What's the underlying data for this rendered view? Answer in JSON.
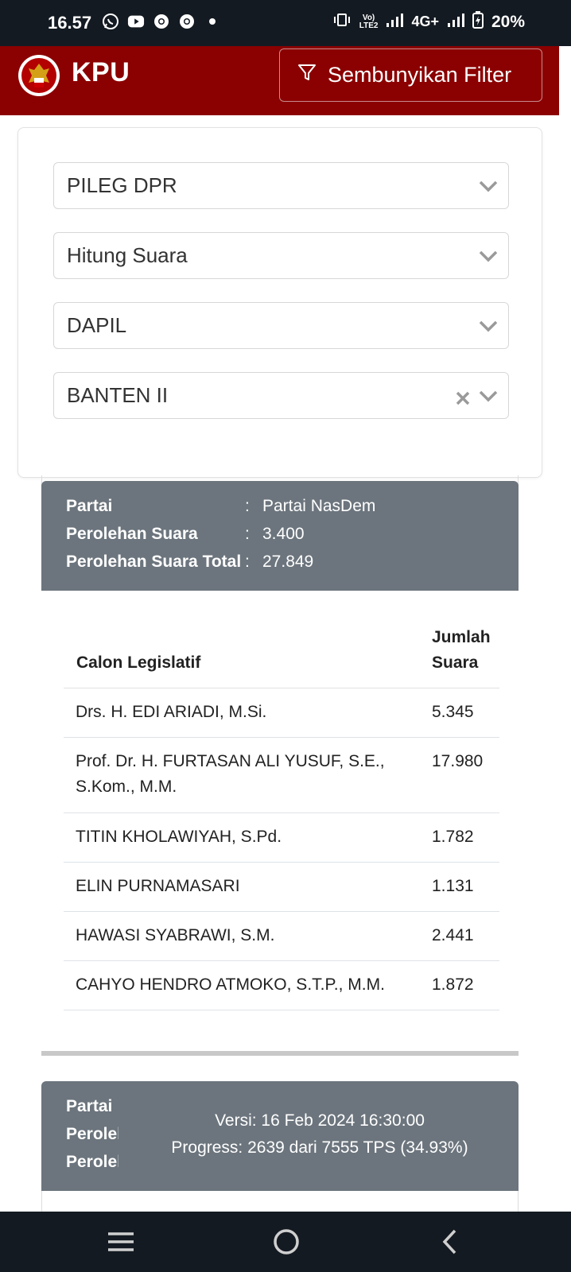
{
  "status_bar": {
    "time": "16.57",
    "network": "4G+",
    "battery": "20%",
    "icons": [
      "whatsapp-icon",
      "youtube-icon",
      "chrome-icon",
      "chrome-icon",
      "dot-icon",
      "vibrate-icon",
      "volte-icon",
      "signal-icon",
      "battery-icon"
    ]
  },
  "header": {
    "brand": "KPU",
    "filter_button": "Sembunyikan Filter",
    "color": "#8b0000"
  },
  "filters": {
    "election": "PILEG DPR",
    "mode": "Hitung Suara",
    "level": "DAPIL",
    "region": "BANTEN II"
  },
  "party_summary": {
    "party_label": "Partai",
    "party_value": "Partai NasDem",
    "votes_label": "Perolehan Suara",
    "votes_value": "3.400",
    "total_label": "Perolehan Suara Total",
    "total_value": "27.849",
    "colon": ":"
  },
  "table": {
    "col_name": "Calon Legislatif",
    "col_votes_1": "Jumlah",
    "col_votes_2": "Suara",
    "rows": [
      {
        "name": "Drs. H. EDI ARIADI, M.Si.",
        "votes": "5.345"
      },
      {
        "name_1": "Prof. Dr. H. FURTASAN ALI YUSUF, S.E.,",
        "name_2": "S.Kom., M.M.",
        "votes": "17.980"
      },
      {
        "name": "TITIN KHOLAWIYAH, S.Pd.",
        "votes": "1.782"
      },
      {
        "name": "ELIN PURNAMASARI",
        "votes": "1.131"
      },
      {
        "name": "HAWASI SYABRAWI, S.M.",
        "votes": "2.441"
      },
      {
        "name": "CAHYO HENDRO ATMOKO, S.T.P., M.M.",
        "votes": "1.872"
      }
    ]
  },
  "next_panel": {
    "party_label": "Partai",
    "votes_label_cut": "Perolel",
    "total_label_cut": "Perolel.",
    "version": "Versi: 16 Feb 2024 16:30:00",
    "progress": "Progress: 2639 dari 7555 TPS (34.93%)"
  },
  "nav": [
    "recents-icon",
    "home-icon",
    "back-icon"
  ]
}
